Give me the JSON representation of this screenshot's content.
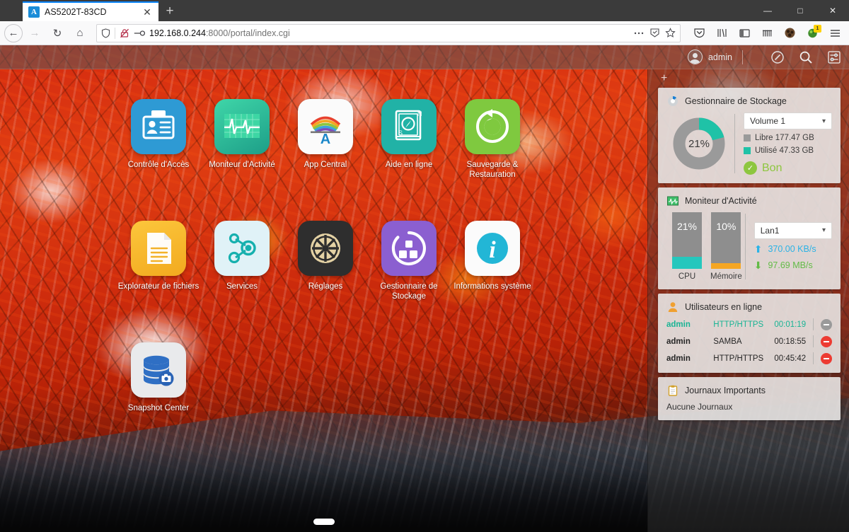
{
  "browser": {
    "tab": {
      "title": "AS5202T-83CD",
      "favicon": "asustor-logo-icon",
      "close_label": "✕"
    },
    "new_tab_label": "+",
    "window_controls": {
      "minimize": "—",
      "maximize": "□",
      "close": "✕"
    },
    "nav": {
      "back": "←",
      "forward": "→",
      "reload": "↻",
      "home": "⌂"
    },
    "url": {
      "host": "192.168.0.244",
      "path": ":8000/portal/index.cgi",
      "full": "192.168.0.244:8000/portal/index.cgi"
    },
    "url_icons": [
      "shield-icon",
      "no-https-icon",
      "key-icon"
    ],
    "urlbar_right": [
      "page-actions-ellipsis",
      "reader-save-icon",
      "bookmark-star-icon"
    ],
    "toolbar_icons": [
      "pocket-icon",
      "library-icon",
      "sidebar-icon",
      "bookmarks-toolbar-icon",
      "account-avatar-icon",
      "extension-icon",
      "menu-hamburger-icon"
    ],
    "extension_badge": "1"
  },
  "nas_header": {
    "username": "admin",
    "icons": [
      "power-icon",
      "search-icon",
      "preferences-icon"
    ]
  },
  "desktop": {
    "add_widget_label": "+",
    "apps": [
      {
        "label": "Contrôle d'Accès",
        "icon": "access-control-icon",
        "tile": "t-access"
      },
      {
        "label": "Moniteur d'Activité",
        "icon": "activity-monitor-icon",
        "tile": "t-monitor"
      },
      {
        "label": "App Central",
        "icon": "app-central-icon",
        "tile": "t-appcentral"
      },
      {
        "label": "Aide en ligne",
        "icon": "online-help-icon",
        "tile": "t-help"
      },
      {
        "label": "Sauvegarde & Restauration",
        "icon": "backup-restore-icon",
        "tile": "t-backup"
      },
      {
        "label": "Explorateur de fichiers",
        "icon": "file-explorer-icon",
        "tile": "t-files"
      },
      {
        "label": "Services",
        "icon": "services-icon",
        "tile": "t-services"
      },
      {
        "label": "Réglages",
        "icon": "settings-gear-icon",
        "tile": "t-settings"
      },
      {
        "label": "Gestionnaire de Stockage",
        "icon": "storage-manager-icon",
        "tile": "t-storage"
      },
      {
        "label": "Informations système",
        "icon": "system-information-icon",
        "tile": "t-sysinfo"
      },
      {
        "label": "Snapshot Center",
        "icon": "snapshot-center-icon",
        "tile": "t-snapshot"
      }
    ],
    "page_indicator": "page-1"
  },
  "widgets": {
    "storage": {
      "title": "Gestionnaire de Stockage",
      "icon": "storage-manager-icon",
      "volume_selected": "Volume 1",
      "percent_label": "21%",
      "percent_value": 21,
      "free_label": "Libre 177.47 GB",
      "used_label": "Utilisé 47.33 GB",
      "status_label": "Bon",
      "colors": {
        "used": "#1fc2a7",
        "free": "#9a9a9a",
        "good": "#8dc63f"
      }
    },
    "activity": {
      "title": "Moniteur d'Activité",
      "icon": "activity-monitor-icon",
      "cpu": {
        "value": "21%",
        "percent": 21,
        "caption": "CPU",
        "color": "#25c7bd"
      },
      "memory": {
        "value": "10%",
        "percent": 10,
        "caption": "Mémoire",
        "color": "#f5a623"
      },
      "interface_selected": "Lan1",
      "upload": "370.00 KB/s",
      "download": "97.69 MB/s",
      "upload_color": "#2bb3e6",
      "download_color": "#62bb46"
    },
    "users": {
      "title": "Utilisateurs en ligne",
      "icon": "user-icon",
      "rows": [
        {
          "name": "admin",
          "protocol": "HTTP/HTTPS",
          "time": "00:01:19",
          "active": true,
          "kick": "disconnect-icon"
        },
        {
          "name": "admin",
          "protocol": "SAMBA",
          "time": "00:18:55",
          "active": false,
          "kick": "disconnect-icon"
        },
        {
          "name": "admin",
          "protocol": "HTTP/HTTPS",
          "time": "00:45:42",
          "active": false,
          "kick": "disconnect-icon"
        }
      ]
    },
    "logs": {
      "title": "Journaux Importants",
      "icon": "clipboard-icon",
      "empty_text": "Aucune Journaux"
    }
  }
}
